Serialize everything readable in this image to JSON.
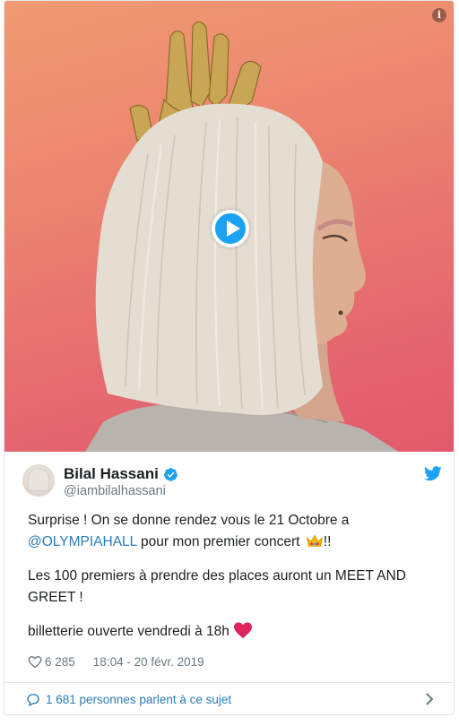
{
  "media": {
    "info_glyph": "i",
    "play_icon": "play-icon"
  },
  "author": {
    "name": "Bilal Hassani",
    "handle": "@iambilalhassani",
    "verified_icon": "verified-badge-icon",
    "platform_icon": "twitter-bird-icon"
  },
  "tweet": {
    "line1_prefix": "Surprise ! On se donne rendez vous le 21 Octobre a",
    "mention": "@OLYMPIAHALL",
    "line2_suffix": " pour mon premier concert ",
    "line2_end": "!!",
    "paragraph2": "Les 100 premiers à prendre des places auront un MEET AND GREET !",
    "paragraph3": "billetterie ouverte vendredi à 18h",
    "emoji_crown": "crown-emoji",
    "emoji_heart": "red-heart-emoji"
  },
  "meta": {
    "likes": "6 285",
    "time": "18:04 - 20 févr. 2019"
  },
  "footer": {
    "conversation": "1 681 personnes parlent à ce sujet"
  },
  "colors": {
    "accent": "#1da1f2",
    "link": "#2b7bb9",
    "muted": "#697882",
    "heart": "#e0245e"
  }
}
